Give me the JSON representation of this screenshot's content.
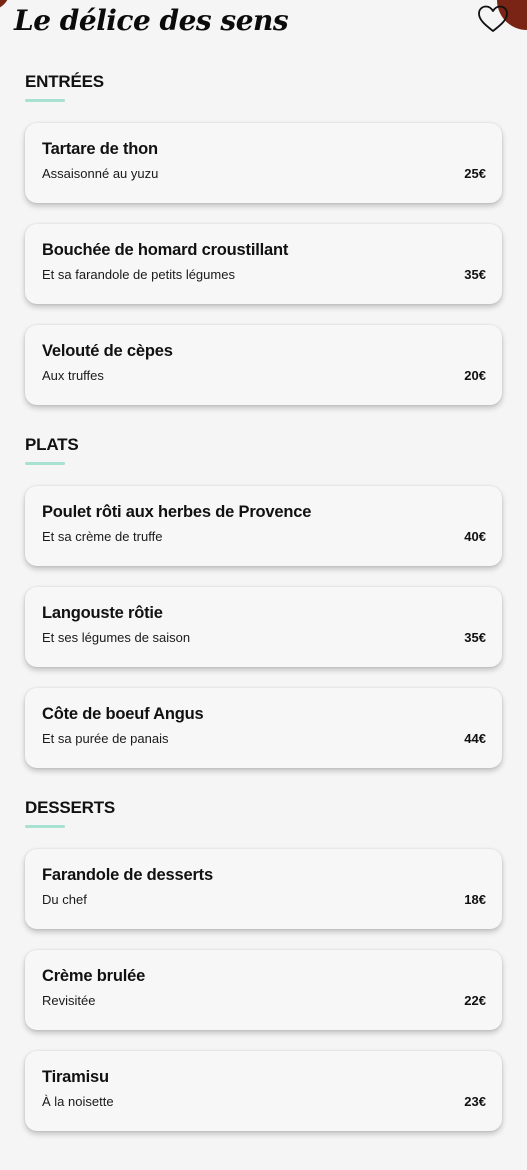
{
  "header": {
    "title": "Le délice des sens",
    "favorite_icon": "heart-outline-icon"
  },
  "colors": {
    "background": "#f5f5f5",
    "accent_underline": "#a8e0d2",
    "corner_accent": "#7a2416"
  },
  "sections": [
    {
      "title": "ENTRÉES",
      "items": [
        {
          "name": "Tartare de thon",
          "description": "Assaisonné au yuzu",
          "price": "25€"
        },
        {
          "name": "Bouchée de homard croustillant",
          "description": "Et sa farandole de petits légumes",
          "price": "35€"
        },
        {
          "name": "Velouté de cèpes",
          "description": "Aux truffes",
          "price": "20€"
        }
      ]
    },
    {
      "title": "PLATS",
      "items": [
        {
          "name": "Poulet rôti aux herbes de Provence",
          "description": "Et sa crème de truffe",
          "price": "40€"
        },
        {
          "name": "Langouste rôtie",
          "description": "Et ses légumes de saison",
          "price": "35€"
        },
        {
          "name": "Côte de boeuf Angus",
          "description": "Et sa purée de panais",
          "price": "44€"
        }
      ]
    },
    {
      "title": "DESSERTS",
      "items": [
        {
          "name": "Farandole de desserts",
          "description": "Du chef",
          "price": "18€"
        },
        {
          "name": "Crème brulée",
          "description": "Revisitée",
          "price": "22€"
        },
        {
          "name": "Tiramisu",
          "description": "À la noisette",
          "price": "23€"
        }
      ]
    }
  ]
}
